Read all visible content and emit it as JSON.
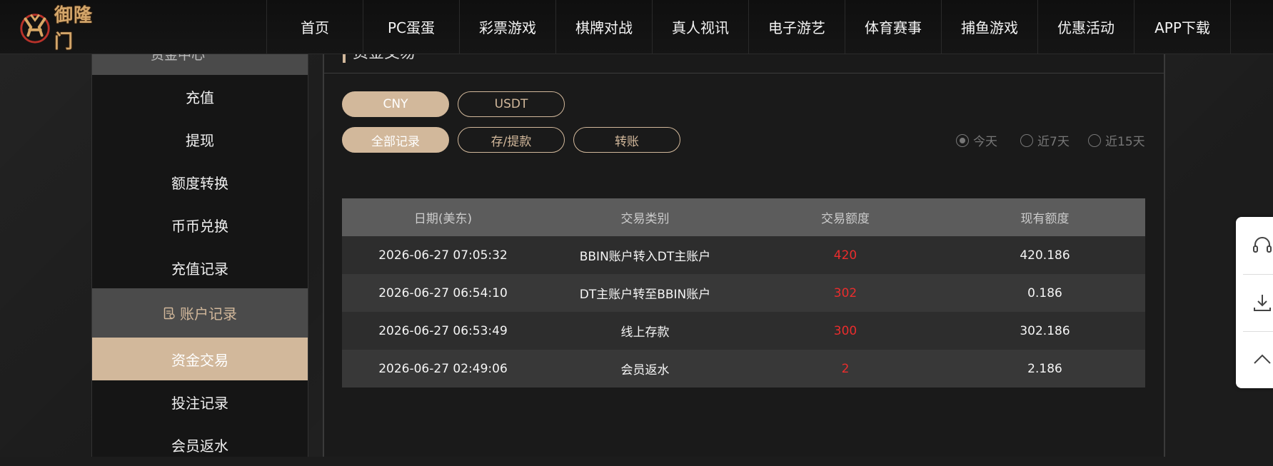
{
  "brand": {
    "logo_text": "御隆门"
  },
  "nav": [
    "首页",
    "PC蛋蛋",
    "彩票游戏",
    "棋牌对战",
    "真人视讯",
    "电子游艺",
    "体育赛事",
    "捕鱼游戏",
    "优惠活动",
    "APP下载"
  ],
  "sidebar": {
    "top_partial": "资金中心",
    "items": [
      "充值",
      "提现",
      "额度转换",
      "币币兑换",
      "充值记录"
    ],
    "group_label": "账户记录",
    "group_items": [
      "资金交易",
      "投注记录",
      "会员返水"
    ]
  },
  "main": {
    "title": "资金交易",
    "currency_tabs": [
      "CNY",
      "USDT"
    ],
    "currency_selected": "CNY",
    "type_tabs": [
      "全部记录",
      "存/提款",
      "转账"
    ],
    "type_selected": "全部记录",
    "range_options": [
      "今天",
      "近7天",
      "近15天"
    ],
    "range_selected": "今天"
  },
  "table": {
    "headers": [
      "日期(美东)",
      "交易类别",
      "交易额度",
      "现有额度"
    ],
    "rows": [
      [
        "2026-06-27 07:05:32",
        "BBIN账户转入DT主账户",
        "420",
        "420.186"
      ],
      [
        "2026-06-27 06:54:10",
        "DT主账户转至BBIN账户",
        "302",
        "0.186"
      ],
      [
        "2026-06-27 06:53:49",
        "线上存款",
        "300",
        "302.186"
      ],
      [
        "2026-06-27 02:49:06",
        "会员返水",
        "2",
        "2.186"
      ]
    ]
  },
  "colors": {
    "accent": "#d2b89b",
    "amount": "#ea2d2d"
  },
  "float_widget": {
    "icons": [
      "headset-icon",
      "download-icon",
      "arrow-up-icon"
    ]
  }
}
